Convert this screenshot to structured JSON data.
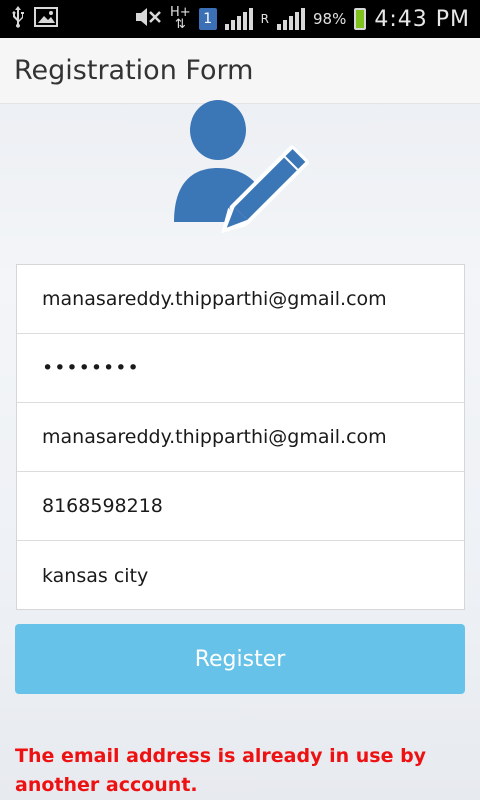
{
  "status_bar": {
    "sim_badge": "1",
    "network_h": "H+",
    "roaming": "R",
    "battery_text": "98%",
    "battery_level": 0.98,
    "time": "4:43 PM",
    "icons": [
      "usb-icon",
      "image-icon",
      "mute-icon",
      "data-icon",
      "sim-icon",
      "signal-icon",
      "roaming-signal-icon",
      "battery-icon"
    ]
  },
  "header": {
    "title": "Registration Form"
  },
  "avatar": {
    "icon": "user-edit-icon",
    "color": "#3b76b6"
  },
  "form": {
    "email": "manasareddy.thipparthi@gmail.com",
    "password": "••••••••",
    "confirm_email": "manasareddy.thipparthi@gmail.com",
    "phone": "8168598218",
    "city": "kansas city"
  },
  "register_button": {
    "label": "Register",
    "color": "#66c2e8"
  },
  "error": {
    "message": "The email address is already in use by another account.",
    "color": "#ee1111"
  }
}
